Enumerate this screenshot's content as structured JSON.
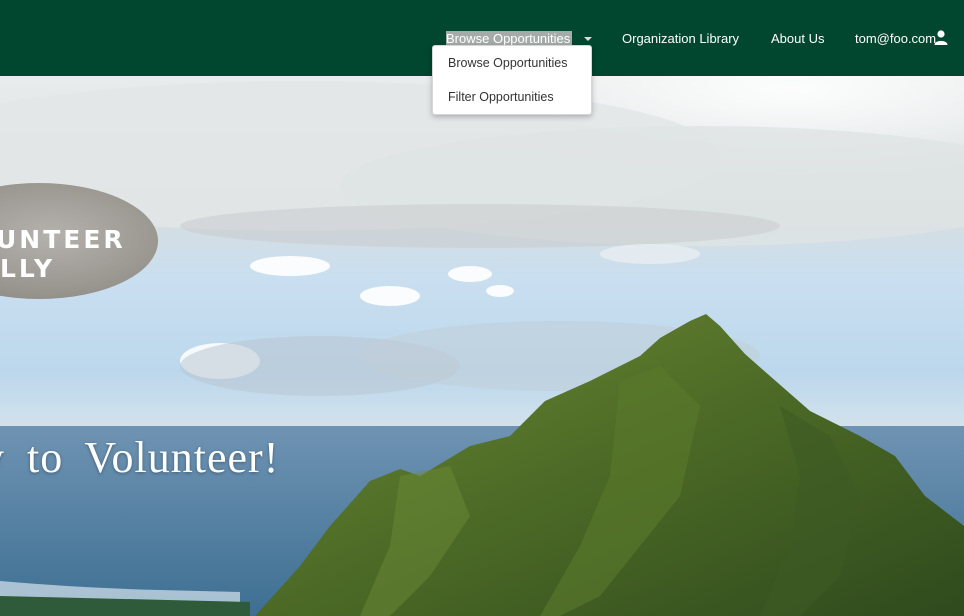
{
  "nav": {
    "items": [
      {
        "label": "Browse Opportunities"
      },
      {
        "label": "Organization Library"
      },
      {
        "label": "About Us"
      },
      {
        "label": "tom@foo.com"
      }
    ],
    "dropdown": [
      {
        "label": "Browse Opportunities"
      },
      {
        "label": "Filter Opportunities"
      }
    ]
  },
  "hero": {
    "logo_line1": "UNTEER",
    "logo_line2": "LLY",
    "headline": "y to Volunteer!"
  },
  "colors": {
    "navbar": "#01462f",
    "active_nav_highlight": "#a4aba8"
  }
}
